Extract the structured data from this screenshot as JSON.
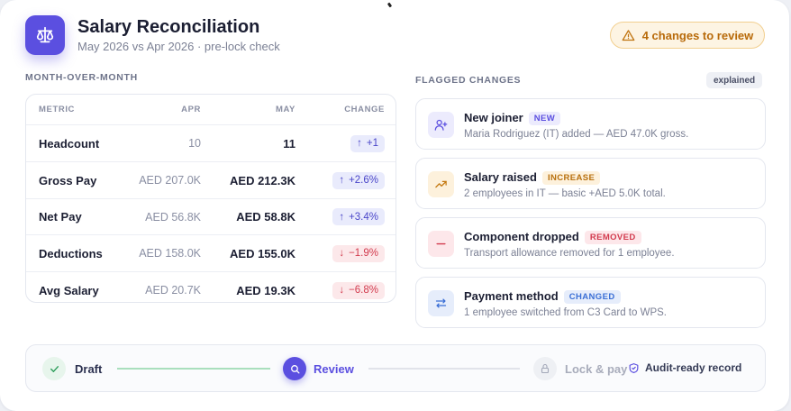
{
  "header": {
    "title": "Salary Reconciliation",
    "subtitle": "May 2026 vs Apr 2026 · pre-lock check",
    "icon": "scales-icon",
    "review_pill": "4 changes to review",
    "review_icon": "warning-triangle-icon"
  },
  "mom": {
    "section_label": "MONTH-OVER-MONTH",
    "columns": {
      "metric": "METRIC",
      "apr": "APR",
      "may": "MAY",
      "change": "CHANGE"
    },
    "rows": [
      {
        "metric": "Headcount",
        "apr": "10",
        "may": "11",
        "change": "+1",
        "direction": "up"
      },
      {
        "metric": "Gross Pay",
        "apr": "AED 207.0K",
        "may": "AED 212.3K",
        "change": "+2.6%",
        "direction": "up"
      },
      {
        "metric": "Net Pay",
        "apr": "AED 56.8K",
        "may": "AED 58.8K",
        "change": "+3.4%",
        "direction": "up"
      },
      {
        "metric": "Deductions",
        "apr": "AED 158.0K",
        "may": "AED 155.0K",
        "change": "−1.9%",
        "direction": "down"
      },
      {
        "metric": "Avg Salary",
        "apr": "AED 20.7K",
        "may": "AED 19.3K",
        "change": "−6.8%",
        "direction": "down"
      }
    ]
  },
  "flagged": {
    "section_label": "FLAGGED CHANGES",
    "explained_badge": "explained",
    "items": [
      {
        "title": "New joiner",
        "tag": "NEW",
        "desc": "Maria Rodriguez (IT) added — AED 47.0K gross.",
        "icon": "user-plus-icon"
      },
      {
        "title": "Salary raised",
        "tag": "INCREASE",
        "desc": "2 employees in IT — basic +AED 5.0K total.",
        "icon": "trending-up-icon"
      },
      {
        "title": "Component dropped",
        "tag": "REMOVED",
        "desc": "Transport allowance removed for 1 employee.",
        "icon": "minus-icon"
      },
      {
        "title": "Payment method",
        "tag": "CHANGED",
        "desc": "1 employee switched from C3 Card to WPS.",
        "icon": "swap-arrows-icon"
      }
    ]
  },
  "stepper": {
    "steps": [
      {
        "label": "Draft",
        "state": "done",
        "icon": "check-icon"
      },
      {
        "label": "Review",
        "state": "current",
        "icon": "search-icon"
      },
      {
        "label": "Lock & pay",
        "state": "locked",
        "icon": "lock-icon"
      }
    ],
    "audit_label": "Audit-ready record",
    "audit_icon": "shield-check-icon"
  },
  "colors": {
    "accent": "#5b4fe0",
    "warning": "#b86a0a",
    "positive": "#4a46c9",
    "negative": "#d23b4e",
    "done": "#2e9e5b"
  }
}
